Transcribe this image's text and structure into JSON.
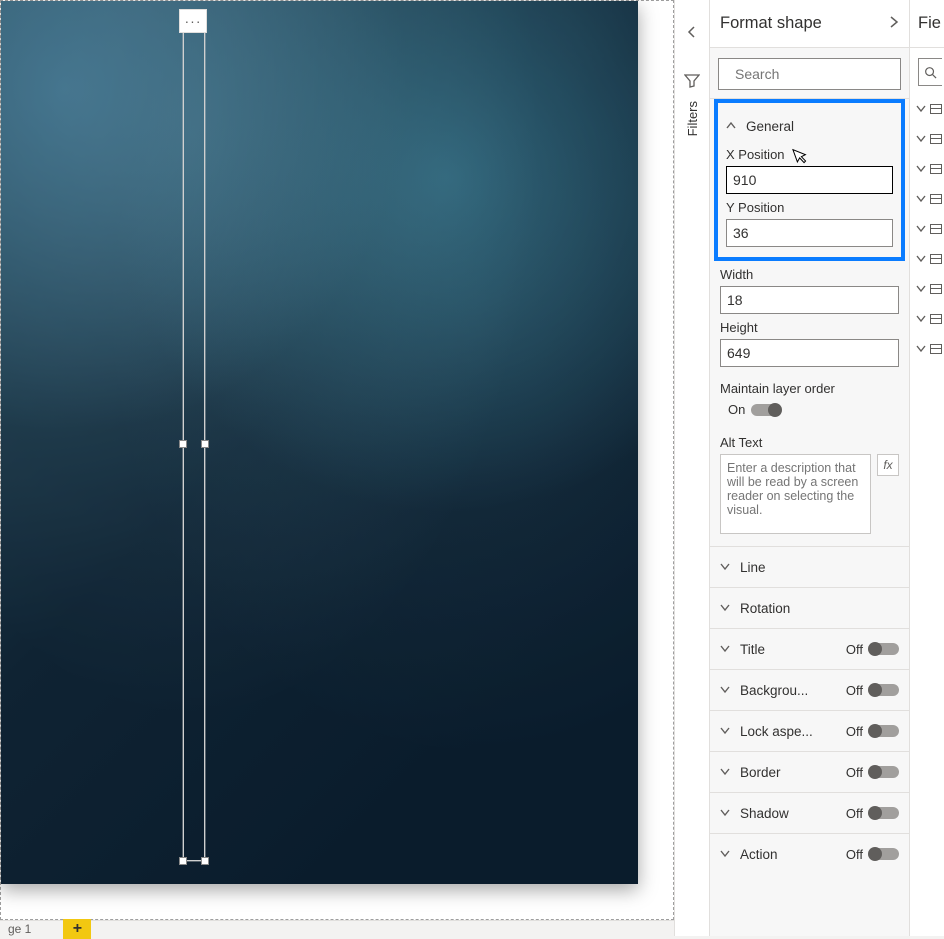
{
  "canvas": {
    "more_menu": "···"
  },
  "page_tabs": {
    "page1": "ge 1",
    "add": "+"
  },
  "filters_pane": {
    "label": "Filters"
  },
  "format_pane": {
    "title": "Format shape",
    "search_placeholder": "Search",
    "general": {
      "title": "General",
      "x_label": "X Position",
      "x_value": "910",
      "y_label": "Y Position",
      "y_value": "36",
      "width_label": "Width",
      "width_value": "18",
      "height_label": "Height",
      "height_value": "649",
      "maintain_label": "Maintain layer order",
      "maintain_state": "On",
      "alt_label": "Alt Text",
      "alt_placeholder": "Enter a description that will be read by a screen reader on selecting the visual.",
      "fx": "fx"
    },
    "sections": [
      {
        "name": "Line",
        "toggle": null
      },
      {
        "name": "Rotation",
        "toggle": null
      },
      {
        "name": "Title",
        "toggle": "Off"
      },
      {
        "name": "Backgrou...",
        "toggle": "Off"
      },
      {
        "name": "Lock aspe...",
        "toggle": "Off"
      },
      {
        "name": "Border",
        "toggle": "Off"
      },
      {
        "name": "Shadow",
        "toggle": "Off"
      },
      {
        "name": "Action",
        "toggle": "Off"
      }
    ]
  },
  "fields_pane": {
    "title": "Fie"
  }
}
